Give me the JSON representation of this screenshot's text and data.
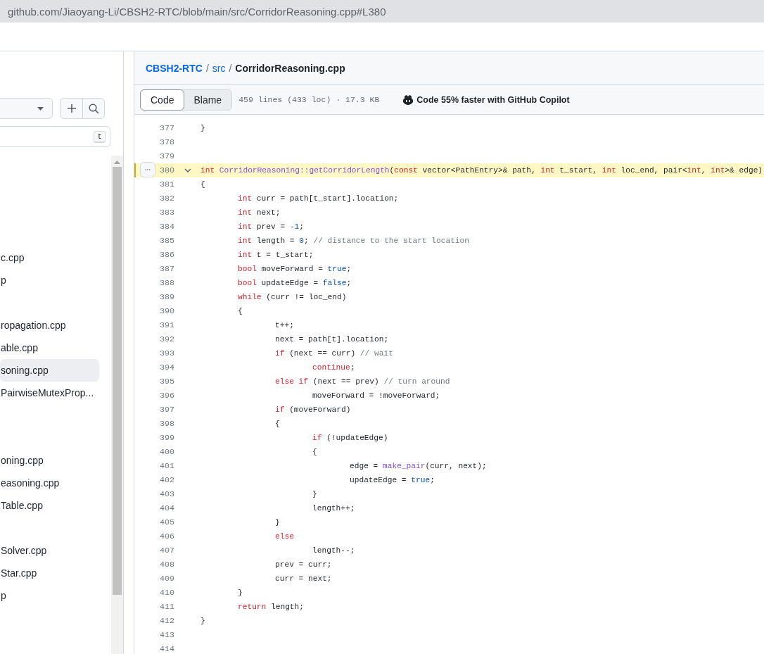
{
  "browser": {
    "url": "github.com/Jiaoyang-Li/CBSH2-RTC/blob/main/src/CorridorReasoning.cpp#L380"
  },
  "sidebar": {
    "filter_key": "t",
    "items": [
      {
        "kind": "folder"
      },
      {
        "kind": "folder"
      },
      {
        "kind": "folder"
      },
      {
        "kind": "folder"
      },
      {
        "kind": "file",
        "text": "c.cpp",
        "selected": false
      },
      {
        "kind": "file",
        "text": "p",
        "selected": false
      },
      {
        "kind": "folder"
      },
      {
        "kind": "file",
        "text": "ropagation.cpp",
        "selected": false
      },
      {
        "kind": "file",
        "text": "able.cpp",
        "selected": false
      },
      {
        "kind": "file",
        "text": "soning.cpp",
        "selected": true
      },
      {
        "kind": "file",
        "text": "PairwiseMutexProp...",
        "selected": false
      },
      {
        "kind": "folder"
      },
      {
        "kind": "folder"
      },
      {
        "kind": "file",
        "text": "oning.cpp",
        "selected": false
      },
      {
        "kind": "file",
        "text": "easoning.cpp",
        "selected": false
      },
      {
        "kind": "file",
        "text": "Table.cpp",
        "selected": false
      },
      {
        "kind": "folder"
      },
      {
        "kind": "file",
        "text": "Solver.cpp",
        "selected": false
      },
      {
        "kind": "file",
        "text": "Star.cpp",
        "selected": false
      },
      {
        "kind": "file",
        "text": "p",
        "selected": false
      }
    ]
  },
  "breadcrumb": [
    {
      "text": "CBSH2-RTC",
      "kind": "link"
    },
    {
      "text": "/",
      "kind": "sep"
    },
    {
      "text": "src",
      "kind": "link"
    },
    {
      "text": "/",
      "kind": "sep"
    },
    {
      "text": "CorridorReasoning.cpp",
      "kind": "current"
    }
  ],
  "toolbar": {
    "tabs": [
      {
        "label": "Code",
        "selected": true
      },
      {
        "label": "Blame",
        "selected": false
      }
    ],
    "info": "459 lines (433 loc) · 17.3 KB",
    "copilot": "Code 55% faster with GitHub Copilot"
  },
  "code": {
    "lines": [
      {
        "number": "377",
        "selected": false,
        "tokens": [
          {
            "text": "}",
            "kind": "plain"
          }
        ]
      },
      {
        "number": "378",
        "selected": false
      },
      {
        "number": "379",
        "selected": false
      },
      {
        "number": "380",
        "selected": true,
        "tokens": [
          {
            "text": "int",
            "kind": "keyword"
          },
          {
            "text": " CorridorReasoning::",
            "kind": "function"
          },
          {
            "text": "getCorridorLength",
            "kind": "function"
          },
          {
            "text": "(",
            "kind": "plain"
          },
          {
            "text": "const",
            "kind": "keyword"
          },
          {
            "text": " vector<PathEntry>& path, ",
            "kind": "plain"
          },
          {
            "text": "int",
            "kind": "keyword"
          },
          {
            "text": " t_start, ",
            "kind": "plain"
          },
          {
            "text": "int",
            "kind": "keyword"
          },
          {
            "text": " loc_end, pair<",
            "kind": "plain"
          },
          {
            "text": "int",
            "kind": "keyword"
          },
          {
            "text": ", ",
            "kind": "plain"
          },
          {
            "text": "int",
            "kind": "keyword"
          },
          {
            "text": ">& edge)",
            "kind": "plain"
          }
        ]
      },
      {
        "number": "381",
        "selected": false,
        "tokens": [
          {
            "text": "{",
            "kind": "plain"
          }
        ]
      },
      {
        "number": "382",
        "selected": false,
        "tokens": [
          {
            "text": "\tint",
            "kind": "keyword"
          },
          {
            "text": " curr = path[t_start].location;",
            "kind": "plain"
          }
        ]
      },
      {
        "number": "383",
        "selected": false,
        "tokens": [
          {
            "text": "\tint",
            "kind": "keyword"
          },
          {
            "text": " next;",
            "kind": "plain"
          }
        ]
      },
      {
        "number": "384",
        "selected": false,
        "tokens": [
          {
            "text": "\tint",
            "kind": "keyword"
          },
          {
            "text": " prev = ",
            "kind": "plain"
          },
          {
            "text": "-1",
            "kind": "constant"
          },
          {
            "text": ";",
            "kind": "plain"
          }
        ]
      },
      {
        "number": "385",
        "selected": false,
        "tokens": [
          {
            "text": "\tint",
            "kind": "keyword"
          },
          {
            "text": " length = ",
            "kind": "plain"
          },
          {
            "text": "0",
            "kind": "constant"
          },
          {
            "text": ";",
            "kind": "plain"
          },
          {
            "text": " // distance to the start location",
            "kind": "comment"
          }
        ]
      },
      {
        "number": "386",
        "selected": false,
        "tokens": [
          {
            "text": "\tint",
            "kind": "keyword"
          },
          {
            "text": " t = t_start;",
            "kind": "plain"
          }
        ]
      },
      {
        "number": "387",
        "selected": false,
        "tokens": [
          {
            "text": "\tbool",
            "kind": "keyword"
          },
          {
            "text": " moveForward = ",
            "kind": "plain"
          },
          {
            "text": "true",
            "kind": "constant"
          },
          {
            "text": ";",
            "kind": "plain"
          }
        ]
      },
      {
        "number": "388",
        "selected": false,
        "tokens": [
          {
            "text": "\tbool",
            "kind": "keyword"
          },
          {
            "text": " updateEdge = ",
            "kind": "plain"
          },
          {
            "text": "false",
            "kind": "constant"
          },
          {
            "text": ";",
            "kind": "plain"
          }
        ]
      },
      {
        "number": "389",
        "selected": false,
        "tokens": [
          {
            "text": "\twhile",
            "kind": "keyword"
          },
          {
            "text": " (curr != loc_end)",
            "kind": "plain"
          }
        ]
      },
      {
        "number": "390",
        "selected": false,
        "tokens": [
          {
            "text": "\t{",
            "kind": "plain"
          }
        ]
      },
      {
        "number": "391",
        "selected": false,
        "tokens": [
          {
            "text": "\t\tt++;",
            "kind": "plain"
          }
        ]
      },
      {
        "number": "392",
        "selected": false,
        "tokens": [
          {
            "text": "\t\tnext = path[t].location;",
            "kind": "plain"
          }
        ]
      },
      {
        "number": "393",
        "selected": false,
        "tokens": [
          {
            "text": "\t\tif",
            "kind": "keyword"
          },
          {
            "text": " (next == curr)",
            "kind": "plain"
          },
          {
            "text": " // wait",
            "kind": "comment"
          }
        ]
      },
      {
        "number": "394",
        "selected": false,
        "tokens": [
          {
            "text": "\t\t\tcontinue",
            "kind": "keyword"
          },
          {
            "text": ";",
            "kind": "plain"
          }
        ]
      },
      {
        "number": "395",
        "selected": false,
        "tokens": [
          {
            "text": "\t\telse if",
            "kind": "keyword"
          },
          {
            "text": " (next == prev)",
            "kind": "plain"
          },
          {
            "text": " // turn around",
            "kind": "comment"
          }
        ]
      },
      {
        "number": "396",
        "selected": false,
        "tokens": [
          {
            "text": "\t\t\tmoveForward = !moveForward;",
            "kind": "plain"
          }
        ]
      },
      {
        "number": "397",
        "selected": false,
        "tokens": [
          {
            "text": "\t\tif",
            "kind": "keyword"
          },
          {
            "text": " (moveForward)",
            "kind": "plain"
          }
        ]
      },
      {
        "number": "398",
        "selected": false,
        "tokens": [
          {
            "text": "\t\t{",
            "kind": "plain"
          }
        ]
      },
      {
        "number": "399",
        "selected": false,
        "tokens": [
          {
            "text": "\t\t\tif",
            "kind": "keyword"
          },
          {
            "text": " (!updateEdge)",
            "kind": "plain"
          }
        ]
      },
      {
        "number": "400",
        "selected": false,
        "tokens": [
          {
            "text": "\t\t\t{",
            "kind": "plain"
          }
        ]
      },
      {
        "number": "401",
        "selected": false,
        "tokens": [
          {
            "text": "\t\t\t\tedge = ",
            "kind": "plain"
          },
          {
            "text": "make_pair",
            "kind": "function"
          },
          {
            "text": "(curr, next);",
            "kind": "plain"
          }
        ]
      },
      {
        "number": "402",
        "selected": false,
        "tokens": [
          {
            "text": "\t\t\t\tupdateEdge = ",
            "kind": "plain"
          },
          {
            "text": "true",
            "kind": "constant"
          },
          {
            "text": ";",
            "kind": "plain"
          }
        ]
      },
      {
        "number": "403",
        "selected": false,
        "tokens": [
          {
            "text": "\t\t\t}",
            "kind": "plain"
          }
        ]
      },
      {
        "number": "404",
        "selected": false,
        "tokens": [
          {
            "text": "\t\t\tlength++;",
            "kind": "plain"
          }
        ]
      },
      {
        "number": "405",
        "selected": false,
        "tokens": [
          {
            "text": "\t\t}",
            "kind": "plain"
          }
        ]
      },
      {
        "number": "406",
        "selected": false,
        "tokens": [
          {
            "text": "\t\telse",
            "kind": "keyword"
          }
        ]
      },
      {
        "number": "407",
        "selected": false,
        "tokens": [
          {
            "text": "\t\t\tlength--;",
            "kind": "plain"
          }
        ]
      },
      {
        "number": "408",
        "selected": false,
        "tokens": [
          {
            "text": "\t\tprev = curr;",
            "kind": "plain"
          }
        ]
      },
      {
        "number": "409",
        "selected": false,
        "tokens": [
          {
            "text": "\t\tcurr = next;",
            "kind": "plain"
          }
        ]
      },
      {
        "number": "410",
        "selected": false,
        "tokens": [
          {
            "text": "\t}",
            "kind": "plain"
          }
        ]
      },
      {
        "number": "411",
        "selected": false,
        "tokens": [
          {
            "text": "\treturn",
            "kind": "keyword"
          },
          {
            "text": " length;",
            "kind": "plain"
          }
        ]
      },
      {
        "number": "412",
        "selected": false,
        "tokens": [
          {
            "text": "}",
            "kind": "plain"
          }
        ]
      },
      {
        "number": "413",
        "selected": false
      },
      {
        "number": "414",
        "selected": false
      }
    ]
  }
}
